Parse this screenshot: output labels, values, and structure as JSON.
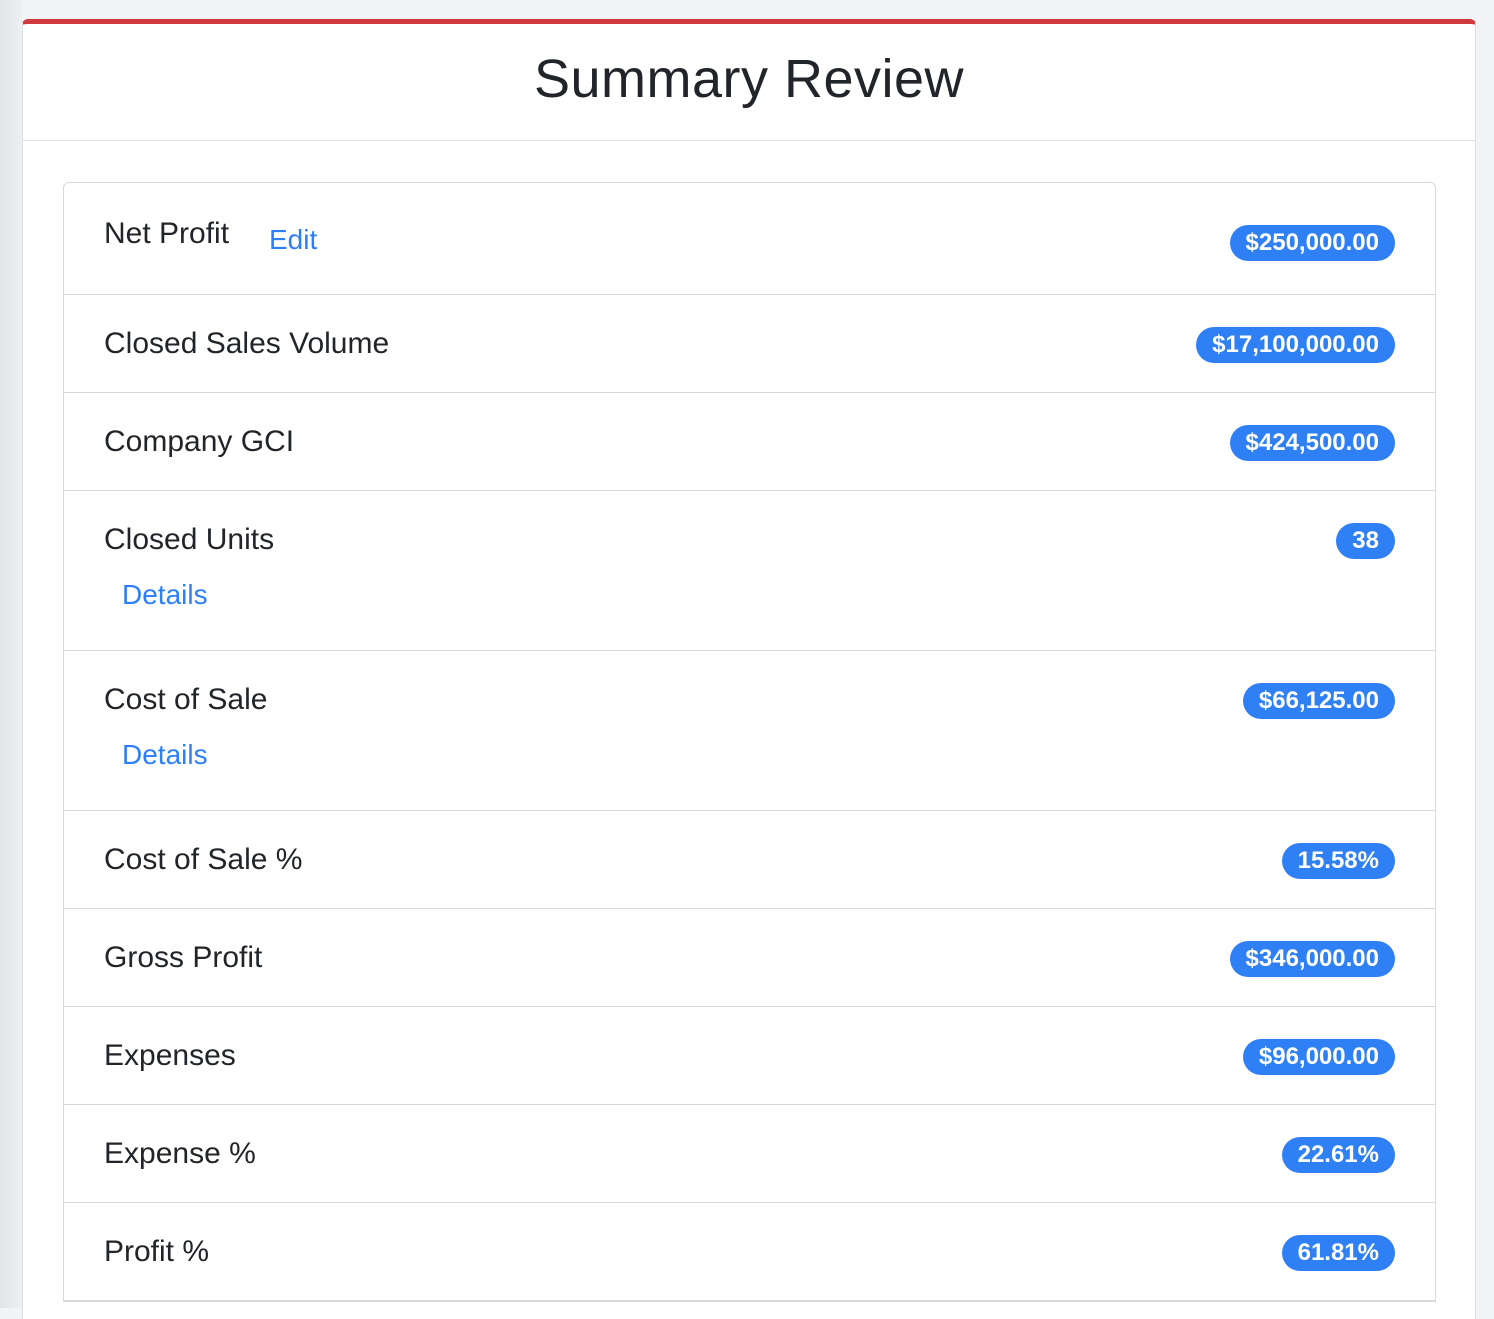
{
  "page": {
    "title": "Summary Review",
    "accent_color": "#d0393e",
    "badge_color": "#2f80f5",
    "link_color": "#2d7ff9"
  },
  "rows": [
    {
      "label": "Net Profit",
      "value": "$250,000.00",
      "link": "Edit"
    },
    {
      "label": "Closed Sales Volume",
      "value": "$17,100,000.00"
    },
    {
      "label": "Company GCI",
      "value": "$424,500.00"
    },
    {
      "label": "Closed Units",
      "value": "38",
      "link": "Details"
    },
    {
      "label": "Cost of Sale",
      "value": "$66,125.00",
      "link": "Details"
    },
    {
      "label": "Cost of Sale %",
      "value": "15.58%"
    },
    {
      "label": "Gross Profit",
      "value": "$346,000.00"
    },
    {
      "label": "Expenses",
      "value": "$96,000.00"
    },
    {
      "label": "Expense %",
      "value": "22.61%"
    },
    {
      "label": "Profit %",
      "value": "61.81%"
    }
  ]
}
